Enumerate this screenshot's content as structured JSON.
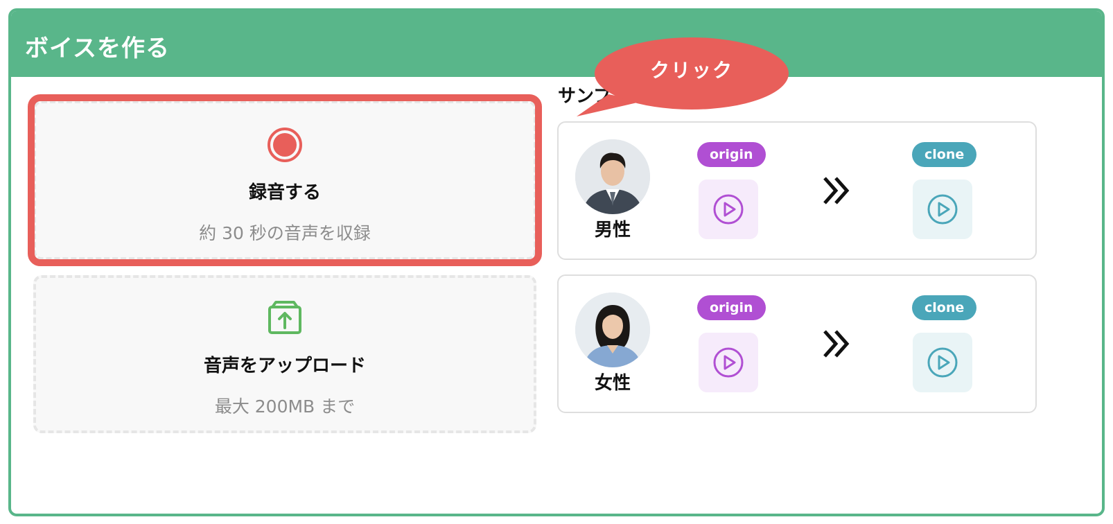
{
  "panel": {
    "title": "ボイスを作る"
  },
  "record_option": {
    "title": "録音する",
    "subtitle": "約 30 秒の音声を収録"
  },
  "upload_option": {
    "title": "音声をアップロード",
    "subtitle": "最大 200MB まで"
  },
  "samples": {
    "heading": "サンプル",
    "items": [
      {
        "label": "男性",
        "origin_badge": "origin",
        "clone_badge": "clone"
      },
      {
        "label": "女性",
        "origin_badge": "origin",
        "clone_badge": "clone"
      }
    ]
  },
  "callout": {
    "text": "クリック"
  },
  "colors": {
    "header_green": "#59b68a",
    "highlight_red": "#e85f5a",
    "origin_purple": "#b04fd3",
    "clone_teal": "#4aa6b9",
    "upload_green": "#5fb860"
  },
  "icons": {
    "record": "record-icon",
    "upload": "upload-box-icon",
    "play": "play-circle-icon",
    "arrow": "double-chevron-right-icon"
  }
}
